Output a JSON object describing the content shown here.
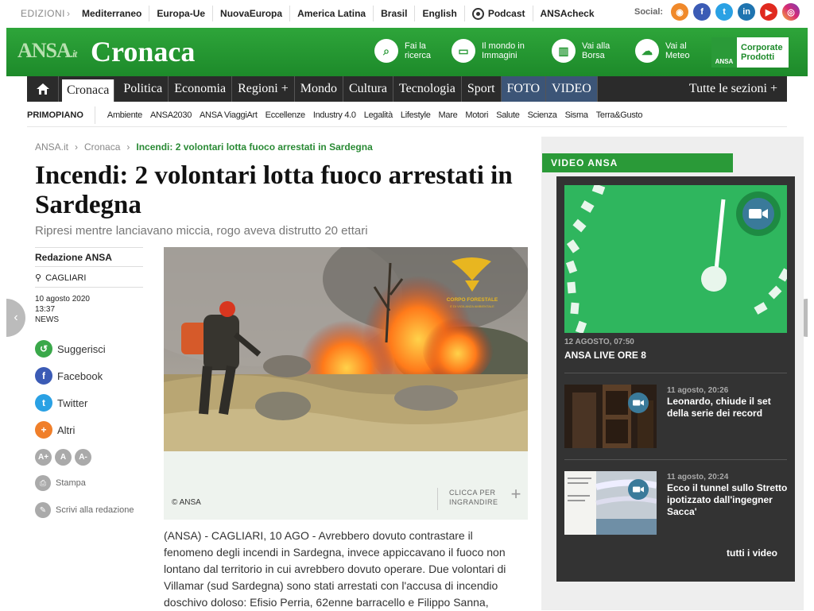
{
  "topbar": {
    "editions_label": "EDIZIONI",
    "links": [
      "Mediterraneo",
      "Europa-Ue",
      "NuovaEuropa",
      "America Latina",
      "Brasil",
      "English",
      "Podcast",
      "ANSAcheck"
    ],
    "social_label": "Social:",
    "social_icons": [
      "rss-icon",
      "facebook-icon",
      "twitter-icon",
      "linkedin-icon",
      "youtube-icon",
      "instagram-icon"
    ]
  },
  "header": {
    "logo_ansa": "ANSA",
    "logo_it": ".it",
    "section": "Cronaca",
    "buttons": [
      {
        "label1": "Fai la",
        "label2": "ricerca"
      },
      {
        "label1": "Il mondo in",
        "label2": "Immagini"
      },
      {
        "label1": "Vai alla",
        "label2": "Borsa"
      },
      {
        "label1": "Vai al",
        "label2": "Meteo"
      }
    ],
    "corporate1": "Corporate",
    "corporate2": "Prodotti",
    "corporate_mark": "ANSA",
    "colors": {
      "brand_green": "#2a9a38",
      "nav_dark": "#2b2b2b"
    }
  },
  "mainnav": {
    "items": [
      "Cronaca",
      "Politica",
      "Economia",
      "Regioni +",
      "Mondo",
      "Cultura",
      "Tecnologia",
      "Sport",
      "FOTO",
      "VIDEO",
      "Tutte le sezioni +"
    ]
  },
  "subnav": {
    "primopiano": "PRIMOPIANO",
    "items": [
      "Ambiente",
      "ANSA2030",
      "ANSA ViaggiArt",
      "Eccellenze",
      "Industry 4.0",
      "Legalità",
      "Lifestyle",
      "Mare",
      "Motori",
      "Salute",
      "Scienza",
      "Sisma",
      "Terra&Gusto"
    ]
  },
  "article": {
    "breadcrumb": [
      "ANSA.it",
      "Cronaca",
      "Incendi: 2 volontari lotta fuoco arrestati in Sardegna"
    ],
    "title": "Incendi: 2 volontari lotta fuoco arrestati in Sardegna",
    "subtitle": "Ripresi mentre lanciavano miccia, rogo aveva distrutto 20 ettari",
    "author": "Redazione ANSA",
    "location": "CAGLIARI",
    "date": "10 agosto 2020",
    "time": "13:37",
    "type": "NEWS",
    "share": [
      "Suggerisci",
      "Facebook",
      "Twitter",
      "Altri"
    ],
    "font_sizes": [
      "A+",
      "A",
      "A-"
    ],
    "print": "Stampa",
    "write": "Scrivi alla redazione",
    "photo_logo1": "CORPO FORESTALE",
    "photo_logo2": "E DI VIGILANZA AMBIENTALE",
    "credit": "© ANSA",
    "enlarge1": "CLICCA PER",
    "enlarge2": "INGRANDIRE",
    "body_lines": [
      "(ANSA) - CAGLIARI, 10 AGO - Avrebbero dovuto contrastare il",
      "fenomeno degli incendi in Sardegna, invece appiccavano il fuoco non",
      "lontano dal territorio in cui avrebbero dovuto operare. Due volontari di",
      "Villamar (sud Sardegna) sono stati arrestati con l'accusa di incendio",
      "doschivo doloso: Efisio Perria, 62enne barracello e Filippo Sanna,"
    ]
  },
  "video": {
    "tag": "VIDEO ANSA",
    "main_date": "12 AGOSTO, 07:50",
    "main_title": "ANSA LIVE ORE 8",
    "items": [
      {
        "date": "11 agosto, 20:26",
        "title": "Leonardo, chiude il set della serie dei record"
      },
      {
        "date": "11 agosto, 20:24",
        "title": "Ecco il tunnel sullo Stretto ipotizzato dall'ingegner Sacca'"
      }
    ],
    "all": "tutti i video"
  }
}
